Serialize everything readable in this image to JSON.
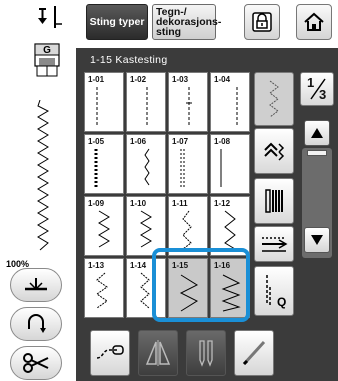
{
  "top_tabs": {
    "utility_label": "Sting typer",
    "decorative_label": "Tegn-/ dekorasjons- sting"
  },
  "panel": {
    "title": "1-15   Kastesting"
  },
  "zoom": "100%",
  "pager": {
    "current": "1",
    "total": "3"
  },
  "stitches": [
    {
      "id": "1-01"
    },
    {
      "id": "1-02"
    },
    {
      "id": "1-03"
    },
    {
      "id": "1-04"
    },
    {
      "id": "1-05"
    },
    {
      "id": "1-06"
    },
    {
      "id": "1-07"
    },
    {
      "id": "1-08"
    },
    {
      "id": "1-09"
    },
    {
      "id": "1-10"
    },
    {
      "id": "1-11"
    },
    {
      "id": "1-12"
    },
    {
      "id": "1-13"
    },
    {
      "id": "1-14"
    },
    {
      "id": "1-15"
    },
    {
      "id": "1-16"
    }
  ],
  "selected_stitch": "1-15",
  "colors": {
    "highlight": "#1a8fd6",
    "panel": "#3b3b3b"
  },
  "side_buttons": {
    "q_label": "Q"
  }
}
